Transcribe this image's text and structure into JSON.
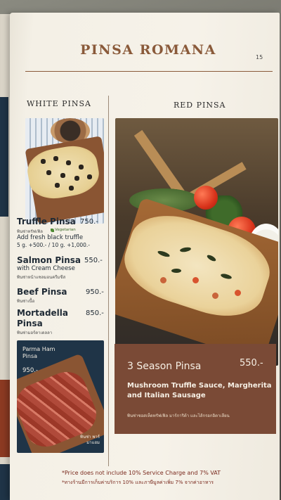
{
  "menu": {
    "title": "PINSA ROMANA",
    "page_number": "15",
    "white_section": "WHITE PINSA",
    "red_section": "RED PINSA",
    "white_items": [
      {
        "name": "Truffle Pinsa",
        "price": "750.-",
        "thai": "พินซ่าทรัฟเฟิล",
        "tag": "Vegetarian",
        "sub1": "Add fresh black truffle",
        "sub2": "5 g. +500.-  /  10 g. +1,000.-"
      },
      {
        "name": "Salmon Pinsa",
        "price": "550.-",
        "sub1": "with Cream Cheese",
        "thai": "พินซ่าหน้าแซลมอนครีมชีส"
      },
      {
        "name": "Beef Pinsa",
        "price": "950.-",
        "thai": "พินซ่าเนื้อ"
      },
      {
        "name": "Mortadella",
        "name2": "Pinsa",
        "price": "850.-",
        "thai": "พินซ่ามอร์ตาเดลลา"
      }
    ],
    "parma": {
      "name": "Parma Ham Pinsa",
      "price": "950.-",
      "thai": "พินซ่า พาร์มาแฮม"
    },
    "feature": {
      "name": "3 Season Pinsa",
      "price": "550.-",
      "desc": "Mushroom Truffle Sauce, Margherita and Italian Sausage",
      "thai": "พินซ่าซอสเห็ดทรัฟเฟิล มาร์การิต้า และไส้กรอกอิตาเลียน"
    },
    "footnote_en": "*Price does not include 10% Service Charge and 7% VAT",
    "footnote_th": "*ทางร้านมีการเก็บค่าบริการ 10% และภาษีมูลค่าเพิ่ม 7% จากค่าอาหาร"
  },
  "colors": {
    "accent": "#8a5a3a",
    "navy": "#1f3447",
    "feature_bg": "#7a4a36",
    "page": "#f6f2e9"
  }
}
